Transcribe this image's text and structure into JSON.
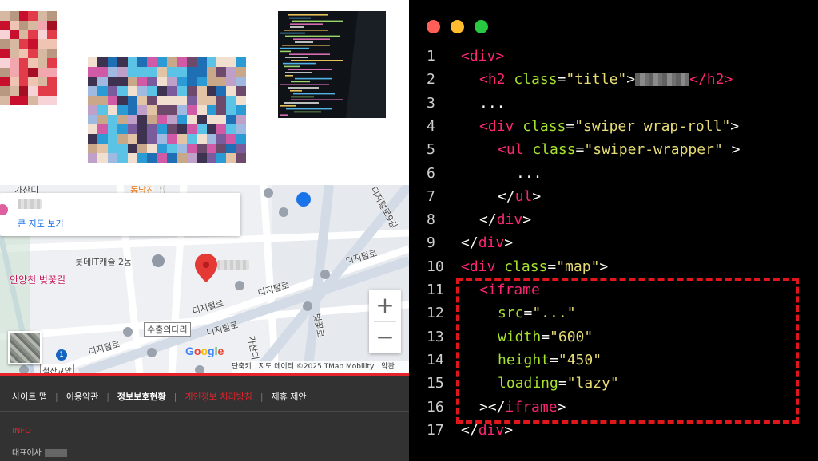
{
  "colors": {
    "accent_red": "#e5232a",
    "footer_bg": "#323232",
    "editor_bg": "#000000",
    "tag": "#f92672",
    "attr": "#a6e22e",
    "string": "#e6db74",
    "highlight_border": "#e0161b"
  },
  "map": {
    "card_link": "큰 지도 보기",
    "labels": {
      "gasan_top": "가산디",
      "restaurant": "동낙진",
      "restaurant_icon": "🍴",
      "lotte": "롯데IT캐슬 2동",
      "anyangcheon": "안양천 벚꽃길",
      "digital1": "디지털로",
      "digital2": "디지털로",
      "digital3": "디지털로",
      "digital4": "디지털로",
      "digital5": "디지털로",
      "road92": "디지털로9길",
      "suchul": "수출의다리",
      "gasan_bottom": "가산디",
      "beotkkot": "벚꽃로",
      "route_badge": "1",
      "cheolsan": "철산교앞"
    },
    "zoom_in": "+",
    "zoom_out": "−",
    "google_logo": "Google",
    "attribution": {
      "shortcuts": "단축키",
      "data": "지도 데이터 ©2025 TMap Mobility",
      "terms": "약관"
    }
  },
  "footer": {
    "nav": [
      {
        "label": "사이트 맵",
        "style": "normal"
      },
      {
        "label": "이용약관",
        "style": "normal"
      },
      {
        "label": "정보보호현황",
        "style": "bold"
      },
      {
        "label": "개인정보 처리방침",
        "style": "red"
      },
      {
        "label": "제휴 제안",
        "style": "normal"
      }
    ],
    "separator": "|",
    "info_heading": "INFO",
    "ceo_label": "대표이사"
  },
  "editor": {
    "window_dots": [
      "#ff5f57",
      "#febc2e",
      "#28c840"
    ],
    "lines": [
      {
        "n": "1",
        "tokens": [
          [
            "tag",
            "<div"
          ],
          [
            "tag",
            ">"
          ]
        ],
        "indent": 0
      },
      {
        "n": "2",
        "tokens": [
          [
            "tag",
            "<h2 "
          ],
          [
            "attr",
            "class"
          ],
          [
            "pun",
            "="
          ],
          [
            "str",
            "\"title\""
          ],
          [
            "pun",
            ">"
          ],
          [
            "redact",
            ""
          ],
          [
            "tag",
            "</h2>"
          ]
        ],
        "indent": 1
      },
      {
        "n": "3",
        "tokens": [
          [
            "pun",
            "..."
          ]
        ],
        "indent": 1
      },
      {
        "n": "4",
        "tokens": [
          [
            "tag",
            "<div "
          ],
          [
            "attr",
            "class"
          ],
          [
            "pun",
            "="
          ],
          [
            "str",
            "\"swiper wrap-roll\""
          ],
          [
            "pun",
            ">"
          ]
        ],
        "indent": 1
      },
      {
        "n": "5",
        "tokens": [
          [
            "tag",
            "<ul "
          ],
          [
            "attr",
            "class"
          ],
          [
            "pun",
            "="
          ],
          [
            "str",
            "\"swiper-wrapper\""
          ],
          [
            "pun",
            " >"
          ]
        ],
        "indent": 2
      },
      {
        "n": "6",
        "tokens": [
          [
            "pun",
            "..."
          ]
        ],
        "indent": 3
      },
      {
        "n": "7",
        "tokens": [
          [
            "pun",
            "</"
          ],
          [
            "tag",
            "ul"
          ],
          [
            "pun",
            ">"
          ]
        ],
        "indent": 2
      },
      {
        "n": "8",
        "tokens": [
          [
            "pun",
            "</"
          ],
          [
            "tag",
            "div"
          ],
          [
            "pun",
            ">"
          ]
        ],
        "indent": 1
      },
      {
        "n": "9",
        "tokens": [
          [
            "pun",
            "</"
          ],
          [
            "tag",
            "div"
          ],
          [
            "pun",
            ">"
          ]
        ],
        "indent": 0
      },
      {
        "n": "10",
        "tokens": [
          [
            "tag",
            "<div "
          ],
          [
            "attr",
            "class"
          ],
          [
            "pun",
            "="
          ],
          [
            "str",
            "\"map\""
          ],
          [
            "pun",
            ">"
          ]
        ],
        "indent": 0
      },
      {
        "n": "11",
        "tokens": [
          [
            "tag",
            "<iframe"
          ]
        ],
        "indent": 1
      },
      {
        "n": "12",
        "tokens": [
          [
            "attr",
            "src"
          ],
          [
            "pun",
            "="
          ],
          [
            "str",
            "\"...\""
          ]
        ],
        "indent": 2
      },
      {
        "n": "13",
        "tokens": [
          [
            "attr",
            "width"
          ],
          [
            "pun",
            "="
          ],
          [
            "str",
            "\"600\""
          ]
        ],
        "indent": 2
      },
      {
        "n": "14",
        "tokens": [
          [
            "attr",
            "height"
          ],
          [
            "pun",
            "="
          ],
          [
            "str",
            "\"450\""
          ]
        ],
        "indent": 2
      },
      {
        "n": "15",
        "tokens": [
          [
            "attr",
            "loading"
          ],
          [
            "pun",
            "="
          ],
          [
            "str",
            "\"lazy\""
          ]
        ],
        "indent": 2
      },
      {
        "n": "16",
        "tokens": [
          [
            "pun",
            "></"
          ],
          [
            "tag",
            "iframe"
          ],
          [
            "pun",
            ">"
          ]
        ],
        "indent": 1
      },
      {
        "n": "17",
        "tokens": [
          [
            "pun",
            "</"
          ],
          [
            "tag",
            "div"
          ],
          [
            "pun",
            ">"
          ]
        ],
        "indent": 0
      }
    ]
  }
}
